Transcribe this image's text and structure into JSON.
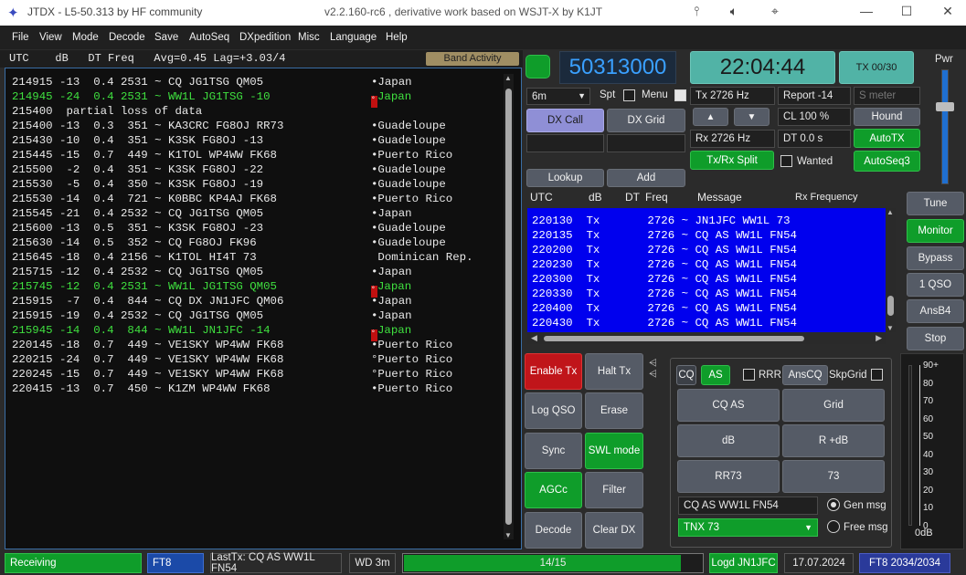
{
  "titlebar": {
    "logo": "✦",
    "title": "JTDX - L5-50.313  by HF community",
    "subtitle": "v2.2.160-rc6 , derivative work based on WSJT-X by K1JT",
    "icons": [
      "tuner-icon",
      "speaker-icon",
      "crosshair-icon"
    ],
    "minimize": "—",
    "maximize": "☐",
    "close": "✕"
  },
  "menu": [
    "File",
    "View",
    "Mode",
    "Decode",
    "Save",
    "AutoSeq",
    "DXpedition",
    "Misc",
    "Language",
    "Help"
  ],
  "band_header": {
    "text": "UTC    dB   DT Freq   Avg=0.45 Lag=+3.03/4",
    "band_activity_button": "Band Activity"
  },
  "band_activity": [
    {
      "text": "214915 -13  0.4 2531 ~ CQ JG1TSG QM05",
      "country": "•Japan",
      "green": false,
      "mark": false
    },
    {
      "text": "214945 -24  0.4 2531 ~ WW1L JG1TSG -10",
      "country": "Japan",
      "green": true,
      "mark": true
    },
    {
      "text": "215400  partial loss of data",
      "country": "",
      "green": false,
      "mark": false
    },
    {
      "text": "215400 -13  0.3  351 ~ KA3CRC FG8OJ RR73",
      "country": "•Guadeloupe",
      "green": false,
      "mark": false
    },
    {
      "text": "215430 -10  0.4  351 ~ K3SK FG8OJ -13",
      "country": "•Guadeloupe",
      "green": false,
      "mark": false
    },
    {
      "text": "215445 -15  0.7  449 ~ K1TOL WP4WW FK68",
      "country": "•Puerto Rico",
      "green": false,
      "mark": false
    },
    {
      "text": "215500  -2  0.4  351 ~ K3SK FG8OJ -22",
      "country": "•Guadeloupe",
      "green": false,
      "mark": false
    },
    {
      "text": "215530  -5  0.4  350 ~ K3SK FG8OJ -19",
      "country": "•Guadeloupe",
      "green": false,
      "mark": false
    },
    {
      "text": "215530 -14  0.4  721 ~ K0BBC KP4AJ FK68",
      "country": "•Puerto Rico",
      "green": false,
      "mark": false
    },
    {
      "text": "215545 -21  0.4 2532 ~ CQ JG1TSG QM05",
      "country": "•Japan",
      "green": false,
      "mark": false
    },
    {
      "text": "215600 -13  0.5  351 ~ K3SK FG8OJ -23",
      "country": "•Guadeloupe",
      "green": false,
      "mark": false
    },
    {
      "text": "215630 -14  0.5  352 ~ CQ FG8OJ FK96",
      "country": "•Guadeloupe",
      "green": false,
      "mark": false
    },
    {
      "text": "215645 -18  0.4 2156 ~ K1TOL HI4T 73",
      "country": " Dominican Rep.",
      "green": false,
      "mark": false
    },
    {
      "text": "215715 -12  0.4 2532 ~ CQ JG1TSG QM05",
      "country": "•Japan",
      "green": false,
      "mark": false
    },
    {
      "text": "215745 -12  0.4 2531 ~ WW1L JG1TSG QM05",
      "country": "Japan",
      "green": true,
      "mark": true
    },
    {
      "text": "215915  -7  0.4  844 ~ CQ DX JN1JFC QM06",
      "country": "•Japan",
      "green": false,
      "mark": false
    },
    {
      "text": "215915 -19  0.4 2532 ~ CQ JG1TSG QM05",
      "country": "•Japan",
      "green": false,
      "mark": false
    },
    {
      "text": "215945 -14  0.4  844 ~ WW1L JN1JFC -14",
      "country": "Japan",
      "green": true,
      "mark": true
    },
    {
      "text": "220145 -18  0.7  449 ~ VE1SKY WP4WW FK68",
      "country": "•Puerto Rico",
      "green": false,
      "mark": false
    },
    {
      "text": "220215 -24  0.7  449 ~ VE1SKY WP4WW FK68",
      "country": "°Puerto Rico",
      "green": false,
      "mark": false
    },
    {
      "text": "220245 -15  0.7  449 ~ VE1SKY WP4WW FK68",
      "country": "°Puerto Rico",
      "green": false,
      "mark": false
    },
    {
      "text": "220415 -13  0.7  450 ~ K1ZM WP4WW FK68",
      "country": "•Puerto Rico",
      "green": false,
      "mark": false
    }
  ],
  "controls": {
    "frequency": "50313000",
    "time": "22:04:44",
    "tx_counter": "TX 00/30",
    "pwr_label": "Pwr",
    "band": "6m",
    "spt_label": "Spt",
    "menu_label": "Menu",
    "tx_freq": "Tx  2726  Hz",
    "rx_freq": "Rx  2726  Hz",
    "report": "Report -14",
    "s_meter_placeholder": "S meter",
    "cl": "CL  100 %",
    "dt": "DT  0.0 s",
    "dx_call_button": "DX Call",
    "dx_grid_button": "DX Grid",
    "lookup_button": "Lookup",
    "add_button": "Add",
    "up_arrow": "▲",
    "down_arrow": "▼",
    "tx_rx_split_button": "Tx/Rx Split",
    "wanted_label": "Wanted",
    "hound_button": "Hound",
    "autotx_button": "AutoTX",
    "autoseq_button": "AutoSeq3"
  },
  "rx_header": {
    "utc": "UTC",
    "db": "dB",
    "dt": "DT",
    "freq": "Freq",
    "message": "Message",
    "rx_freq": "Rx Frequency"
  },
  "tx_rows": [
    "220130  Tx       2726 ~ JN1JFC WW1L 73",
    "220135  Tx       2726 ~ CQ AS WW1L FN54",
    "220200  Tx       2726 ~ CQ AS WW1L FN54",
    "220230  Tx       2726 ~ CQ AS WW1L FN54",
    "220300  Tx       2726 ~ CQ AS WW1L FN54",
    "220330  Tx       2726 ~ CQ AS WW1L FN54",
    "220400  Tx       2726 ~ CQ AS WW1L FN54",
    "220430  Tx       2726 ~ CQ AS WW1L FN54"
  ],
  "right_buttons": [
    "Tune",
    "Monitor",
    "Bypass",
    "1 QSO",
    "AnsB4",
    "Stop"
  ],
  "action_buttons": {
    "enable_tx": "Enable Tx",
    "halt_tx": "Halt Tx",
    "log_qso": "Log QSO",
    "erase": "Erase",
    "sync": "Sync",
    "swl_mode": "SWL mode",
    "agcc": "AGCc",
    "filter": "Filter",
    "decode": "Decode",
    "clear_dx": "Clear DX"
  },
  "message_panel": {
    "cq": "CQ",
    "as": "AS",
    "rrr": "RRR",
    "anscq": "AnsCQ",
    "skpgrid": "SkpGrid",
    "cq_as": "CQ AS",
    "grid": "Grid",
    "db": "dB",
    "r_db": "R +dB",
    "rr73": "RR73",
    "seventy_three": "73",
    "gen_msg_value": "CQ AS WW1L FN54",
    "gen_msg_label": "Gen msg",
    "free_msg_value": "TNX 73",
    "free_msg_label": "Free msg"
  },
  "meter": {
    "scale": [
      "90+",
      "80",
      "70",
      "60",
      "50",
      "40",
      "30",
      "20",
      "10",
      "0"
    ],
    "reading": "0dB"
  },
  "statusbar": {
    "state": "Receiving",
    "mode": "FT8",
    "last_tx": "LastTx: CQ AS WW1L FN54",
    "wd": "WD 3m",
    "progress_text": "14/15",
    "progress_fraction": 0.93,
    "logd": "Logd JN1JFC",
    "date": "17.07.2024",
    "counter": "FT8  2034/2034"
  },
  "colors": {
    "green": "#0f9d2a",
    "red": "#c0151a",
    "tx_list_bg": "#0000ee",
    "freq_fg": "#3aa0ff",
    "time_bg": "#51b3a6"
  }
}
